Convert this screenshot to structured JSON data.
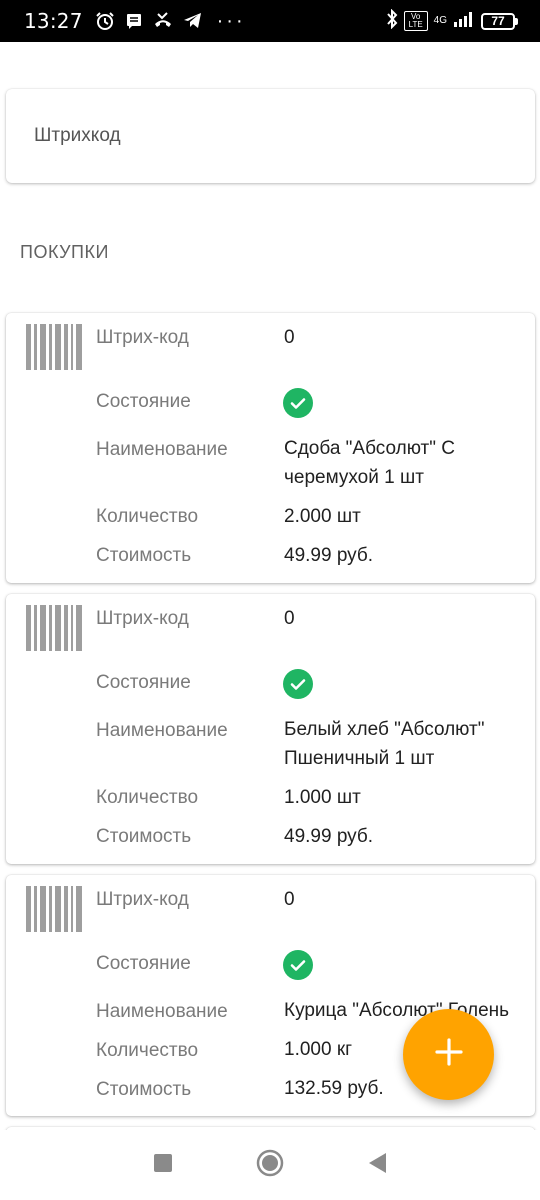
{
  "status_bar": {
    "time": "13:27",
    "network": "4G",
    "volte": "Vo LTE",
    "battery": "77",
    "more": "···"
  },
  "barcode_field": {
    "label": "Штрихкод"
  },
  "section_title": "ПОКУПКИ",
  "labels": {
    "barcode": "Штрих-код",
    "state": "Состояние",
    "name": "Наименование",
    "quantity": "Количество",
    "cost": "Стоимость"
  },
  "purchases": [
    {
      "barcode": "0",
      "state": "ok",
      "name_line1": "Сдоба \"Абсолют\" С",
      "name_line2": "черемухой 1 шт",
      "quantity": "2.000 шт",
      "cost": "49.99 руб."
    },
    {
      "barcode": "0",
      "state": "ok",
      "name_line1": "Белый хлеб \"Абсолют\"",
      "name_line2": "Пшеничный 1 шт",
      "quantity": "1.000 шт",
      "cost": "49.99 руб."
    },
    {
      "barcode": "0",
      "state": "ok",
      "name_line1": "Курица \"Абсолют\" Голень",
      "name_line2": "",
      "quantity": "1.000 кг",
      "cost": "132.59 руб."
    }
  ],
  "colors": {
    "accent": "#ffa300",
    "success": "#1fb563",
    "label": "#7a7a7a"
  },
  "icons": [
    "alarm-icon",
    "message-icon",
    "missed-call-icon",
    "telegram-icon",
    "bluetooth-icon",
    "signal-icon",
    "battery-icon",
    "barcode-icon",
    "check-icon",
    "plus-icon",
    "recents-icon",
    "home-icon",
    "back-icon"
  ]
}
